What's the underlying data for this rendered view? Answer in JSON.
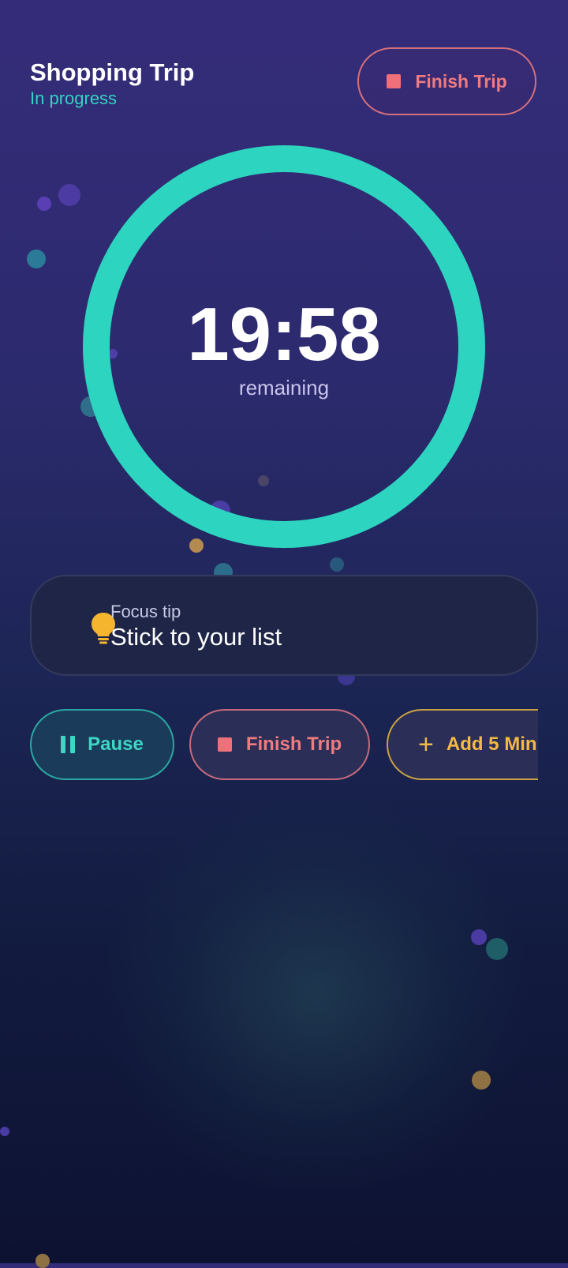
{
  "header": {
    "title": "Shopping Trip",
    "status": "In progress"
  },
  "top_action": {
    "label": "Finish Trip",
    "icon": "stop-icon"
  },
  "timer": {
    "time": "19:58",
    "label": "remaining",
    "progress_fraction": 1.0
  },
  "tip": {
    "heading": "Focus tip",
    "text": "Stick to your list",
    "icon": "lightbulb-icon"
  },
  "actions": [
    {
      "label": "Pause",
      "icon": "pause-icon"
    },
    {
      "label": "Finish Trip",
      "icon": "stop-icon"
    },
    {
      "label": "Add 5 Min",
      "icon": "plus-icon"
    }
  ],
  "colors": {
    "accent_teal": "#2dd4bf",
    "danger_coral": "#f07b80",
    "warning_amber": "#f5b946",
    "background_top": "#352c79",
    "background_bottom": "#0d1232"
  }
}
